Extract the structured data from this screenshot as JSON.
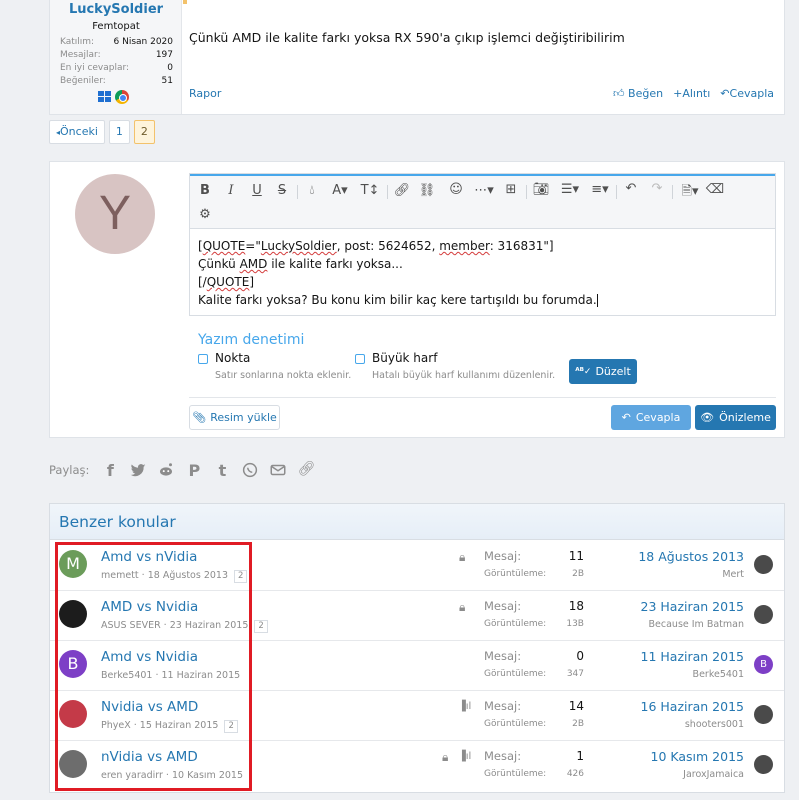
{
  "post": {
    "username": "LuckySoldier",
    "user_title": "Femtopat",
    "stats": [
      {
        "label": "Katılım:",
        "value": "6 Nisan 2020"
      },
      {
        "label": "Mesajlar:",
        "value": "197"
      },
      {
        "label": "En iyi cevaplar:",
        "value": "0"
      },
      {
        "label": "Beğeniler:",
        "value": "51"
      }
    ],
    "message": "Çünkü AMD ile kalite farkı yoksa RX 590'a çıkıp işlemci değiştiribilirim",
    "report_label": "Rapor",
    "like_label": "Beğen",
    "quote_label": "Alıntı",
    "reply_label": "Cevapla"
  },
  "pagination": {
    "prev_label": "Önceki",
    "pages": [
      "1",
      "2"
    ],
    "current_page": "2"
  },
  "reply": {
    "avatar_letter": "Y",
    "avatar_color": "#d8c4c3",
    "editor_lines": [
      "[QUOTE=\"LuckySoldier, post: 5624652, member: 316831\"]",
      "Çünkü AMD ile kalite farkı yoksa...",
      "[/QUOTE]",
      "Kalite farkı yoksa? Bu konu kim bilir kaç kere tartışıldı bu forumda."
    ],
    "spellcheck_title": "Yazım denetimi",
    "options": [
      {
        "label": "Nokta",
        "hint": "Satır sonlarına nokta eklenir."
      },
      {
        "label": "Büyük harf",
        "hint": "Hatalı büyük harf kullanımı düzenlenir."
      }
    ],
    "fix_label": "Düzelt",
    "upload_label": "Resim yükle",
    "submit_label": "Cevapla",
    "preview_label": "Önizleme"
  },
  "share": {
    "label": "Paylaş:"
  },
  "similar": {
    "title": "Benzer konular",
    "key_messages": "Mesaj:",
    "key_views": "Görüntüleme:",
    "threads": [
      {
        "avatar_letter": "M",
        "avatar_color": "#6b9c5a",
        "title": "Amd vs nVidia",
        "meta": "memett · 18 Ağustos 2013",
        "pages": "2",
        "locked": true,
        "poll": false,
        "messages": "11",
        "views": "2B",
        "last_date": "18 Ağustos 2013",
        "last_user": "Mert"
      },
      {
        "avatar_letter": "",
        "avatar_color": "#1c1c1c",
        "title": "AMD vs Nvidia",
        "meta": "ASUS SEVER · 23 Haziran 2015",
        "pages": "2",
        "locked": true,
        "poll": false,
        "messages": "18",
        "views": "13B",
        "last_date": "23 Haziran 2015",
        "last_user": "Because Im Batman"
      },
      {
        "avatar_letter": "B",
        "avatar_color": "#7d3fc6",
        "title": "Amd vs Nvidia",
        "meta": "Berke5401 · 11 Haziran 2015",
        "pages": "",
        "locked": false,
        "poll": false,
        "messages": "0",
        "views": "347",
        "last_date": "11 Haziran 2015",
        "last_user": "Berke5401"
      },
      {
        "avatar_letter": "",
        "avatar_color": "#c43a48",
        "title": "Nvidia vs AMD",
        "meta": "PhyeX · 15 Haziran 2015",
        "pages": "2",
        "locked": false,
        "poll": true,
        "messages": "14",
        "views": "2B",
        "last_date": "16 Haziran 2015",
        "last_user": "shooters001"
      },
      {
        "avatar_letter": "",
        "avatar_color": "#6d6d6d",
        "title": "nVidia vs AMD",
        "meta": "eren yaradirr · 10 Kasım 2015",
        "pages": "",
        "locked": true,
        "poll": true,
        "messages": "1",
        "views": "426",
        "last_date": "10 Kasım 2015",
        "last_user": "JaroxJamaica"
      }
    ]
  },
  "colors": {
    "link": "#2577b1",
    "accent": "#47a7eb",
    "highlight_box": "#e01b24"
  }
}
